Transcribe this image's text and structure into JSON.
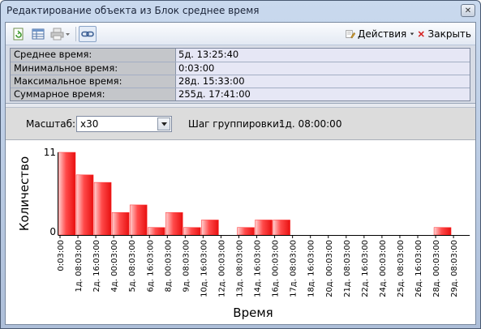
{
  "window": {
    "title": "Редактирование объекта из Блок среднее время",
    "close_glyph": "✕"
  },
  "toolbar": {
    "actions_label": "Действия",
    "close_label": "Закрыть",
    "icons": [
      "refresh-icon",
      "table-icon",
      "printer-icon",
      "link-icon",
      "actions-icon",
      "close-red-icon"
    ]
  },
  "info": {
    "rows": [
      {
        "label": "Среднее время:",
        "value": "5д. 13:25:40"
      },
      {
        "label": "Минимальное время:",
        "value": "0:03:00"
      },
      {
        "label": "Максимальное время:",
        "value": "28д. 15:33:00"
      },
      {
        "label": "Суммарное время:",
        "value": "255д. 17:41:00"
      }
    ]
  },
  "controls": {
    "scale_label": "Масштаб:",
    "scale_value": "x30",
    "step_label": "Шаг группировки:",
    "step_value": "1д. 08:00:00"
  },
  "chart_data": {
    "type": "bar",
    "xlabel": "Время",
    "ylabel": "Количество",
    "ylim": [
      0,
      11
    ],
    "y_ticks": [
      "0",
      "11"
    ],
    "bar_color": "#ff2a2a",
    "categories": [
      "0:03:00",
      "1д. 08:03:00",
      "2д. 16:03:00",
      "4д. 00:03:00",
      "5д. 08:03:00",
      "6д. 16:03:00",
      "8д. 00:03:00",
      "9д. 08:03:00",
      "10д. 16:03:00",
      "12д. 00:03:00",
      "13д. 08:03:00",
      "14д. 16:03:00",
      "16д. 00:03:00",
      "17д. 08:03:00",
      "18д. 16:03:00",
      "20д. 00:03:00",
      "21д. 08:03:00",
      "22д. 16:03:00",
      "24д. 00:03:00",
      "25д. 08:03:00",
      "26д. 16:03:00",
      "28д. 00:03:00",
      "29д. 08:03:00"
    ],
    "values": [
      11,
      8,
      7,
      3,
      4,
      1,
      3,
      1,
      2,
      0,
      1,
      2,
      2,
      0,
      0,
      0,
      0,
      0,
      0,
      0,
      0,
      1
    ]
  }
}
